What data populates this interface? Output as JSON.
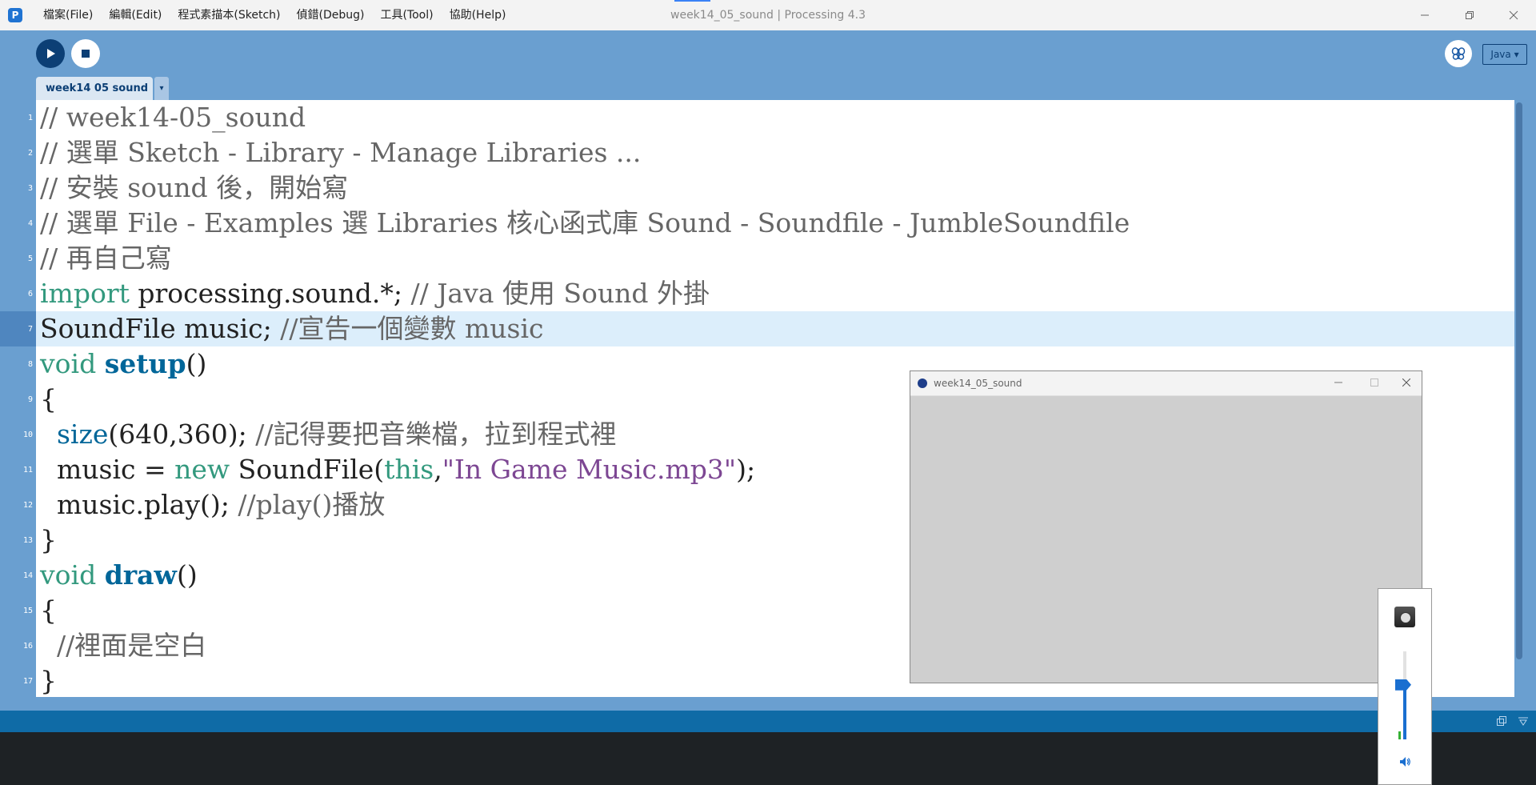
{
  "titlebar": {
    "window_title": "week14_05_sound | Processing 4.3",
    "menus": [
      "檔案(File)",
      "編輯(Edit)",
      "程式素描本(Sketch)",
      "偵錯(Debug)",
      "工具(Tool)",
      "協助(Help)"
    ],
    "controls": [
      "minimize-icon",
      "restore-icon",
      "close-icon"
    ]
  },
  "toolbar": {
    "run_icon": "play-icon",
    "stop_icon": "stop-icon",
    "debug_icon": "butterfly-icon",
    "mode_label": "Java ▾"
  },
  "tabs": [
    {
      "label": "week14 05 sound",
      "active": true
    }
  ],
  "tab_menu_icon": "▾",
  "editor": {
    "current_line": 7,
    "line_numbers": [
      "1",
      "2",
      "3",
      "4",
      "5",
      "6",
      "7",
      "8",
      "9",
      "10",
      "11",
      "12",
      "13",
      "14",
      "15",
      "16",
      "17"
    ],
    "lines": [
      [
        {
          "t": "// week14-05_sound",
          "c": "comment"
        }
      ],
      [
        {
          "t": "// 選單 Sketch - Library - Manage Libraries ...",
          "c": "comment"
        }
      ],
      [
        {
          "t": "// 安裝 sound 後，開始寫",
          "c": "comment"
        }
      ],
      [
        {
          "t": "// 選單 File - Examples 選 Libraries 核心函式庫 Sound - Soundfile - JumbleSoundfile",
          "c": "comment"
        }
      ],
      [
        {
          "t": "// 再自己寫",
          "c": "comment"
        }
      ],
      [
        {
          "t": "import",
          "c": "kw"
        },
        {
          "t": " processing.sound.*; ",
          "c": "plain"
        },
        {
          "t": "// Java 使用 Sound 外掛",
          "c": "comment"
        }
      ],
      [
        {
          "t": "SoundFile music; ",
          "c": "plain"
        },
        {
          "t": "//宣告一個變數 music",
          "c": "comment"
        }
      ],
      [
        {
          "t": "void",
          "c": "kw"
        },
        {
          "t": " ",
          "c": "plain"
        },
        {
          "t": "setup",
          "c": "fn-b"
        },
        {
          "t": "()",
          "c": "plain"
        }
      ],
      [
        {
          "t": "{",
          "c": "plain"
        }
      ],
      [
        {
          "t": "  ",
          "c": "plain"
        },
        {
          "t": "size",
          "c": "fn"
        },
        {
          "t": "(640,360); ",
          "c": "plain"
        },
        {
          "t": "//記得要把音樂檔，拉到程式裡",
          "c": "comment"
        }
      ],
      [
        {
          "t": "  music = ",
          "c": "plain"
        },
        {
          "t": "new",
          "c": "kw"
        },
        {
          "t": " SoundFile(",
          "c": "plain"
        },
        {
          "t": "this",
          "c": "this"
        },
        {
          "t": ",",
          "c": "plain"
        },
        {
          "t": "\"In Game Music.mp3\"",
          "c": "str"
        },
        {
          "t": ");",
          "c": "plain"
        }
      ],
      [
        {
          "t": "  music.play(); ",
          "c": "plain"
        },
        {
          "t": "//play()播放",
          "c": "comment"
        }
      ],
      [
        {
          "t": "}",
          "c": "plain"
        }
      ],
      [
        {
          "t": "void",
          "c": "kw"
        },
        {
          "t": " ",
          "c": "plain"
        },
        {
          "t": "draw",
          "c": "fn-b"
        },
        {
          "t": "()",
          "c": "plain"
        }
      ],
      [
        {
          "t": "{",
          "c": "plain"
        }
      ],
      [
        {
          "t": "  ",
          "c": "plain"
        },
        {
          "t": "//裡面是空白",
          "c": "comment"
        }
      ],
      [
        {
          "t": "}",
          "c": "plain"
        }
      ]
    ]
  },
  "sketch_window": {
    "title": "week14_05_sound",
    "controls": [
      "minimize-icon",
      "maximize-icon",
      "close-icon"
    ]
  },
  "volume_popup": {
    "device_icon": "speaker-device-icon",
    "level_fraction": 0.62,
    "mute_icon": "volume-icon"
  },
  "console_icons": [
    "copy-icon",
    "filter-icon"
  ],
  "colors": {
    "toolbar": "#6a9fd0",
    "run_button": "#0c3f75",
    "status_bar": "#0f6ba6",
    "console": "#1e2225",
    "current_line": "#dceefb"
  }
}
